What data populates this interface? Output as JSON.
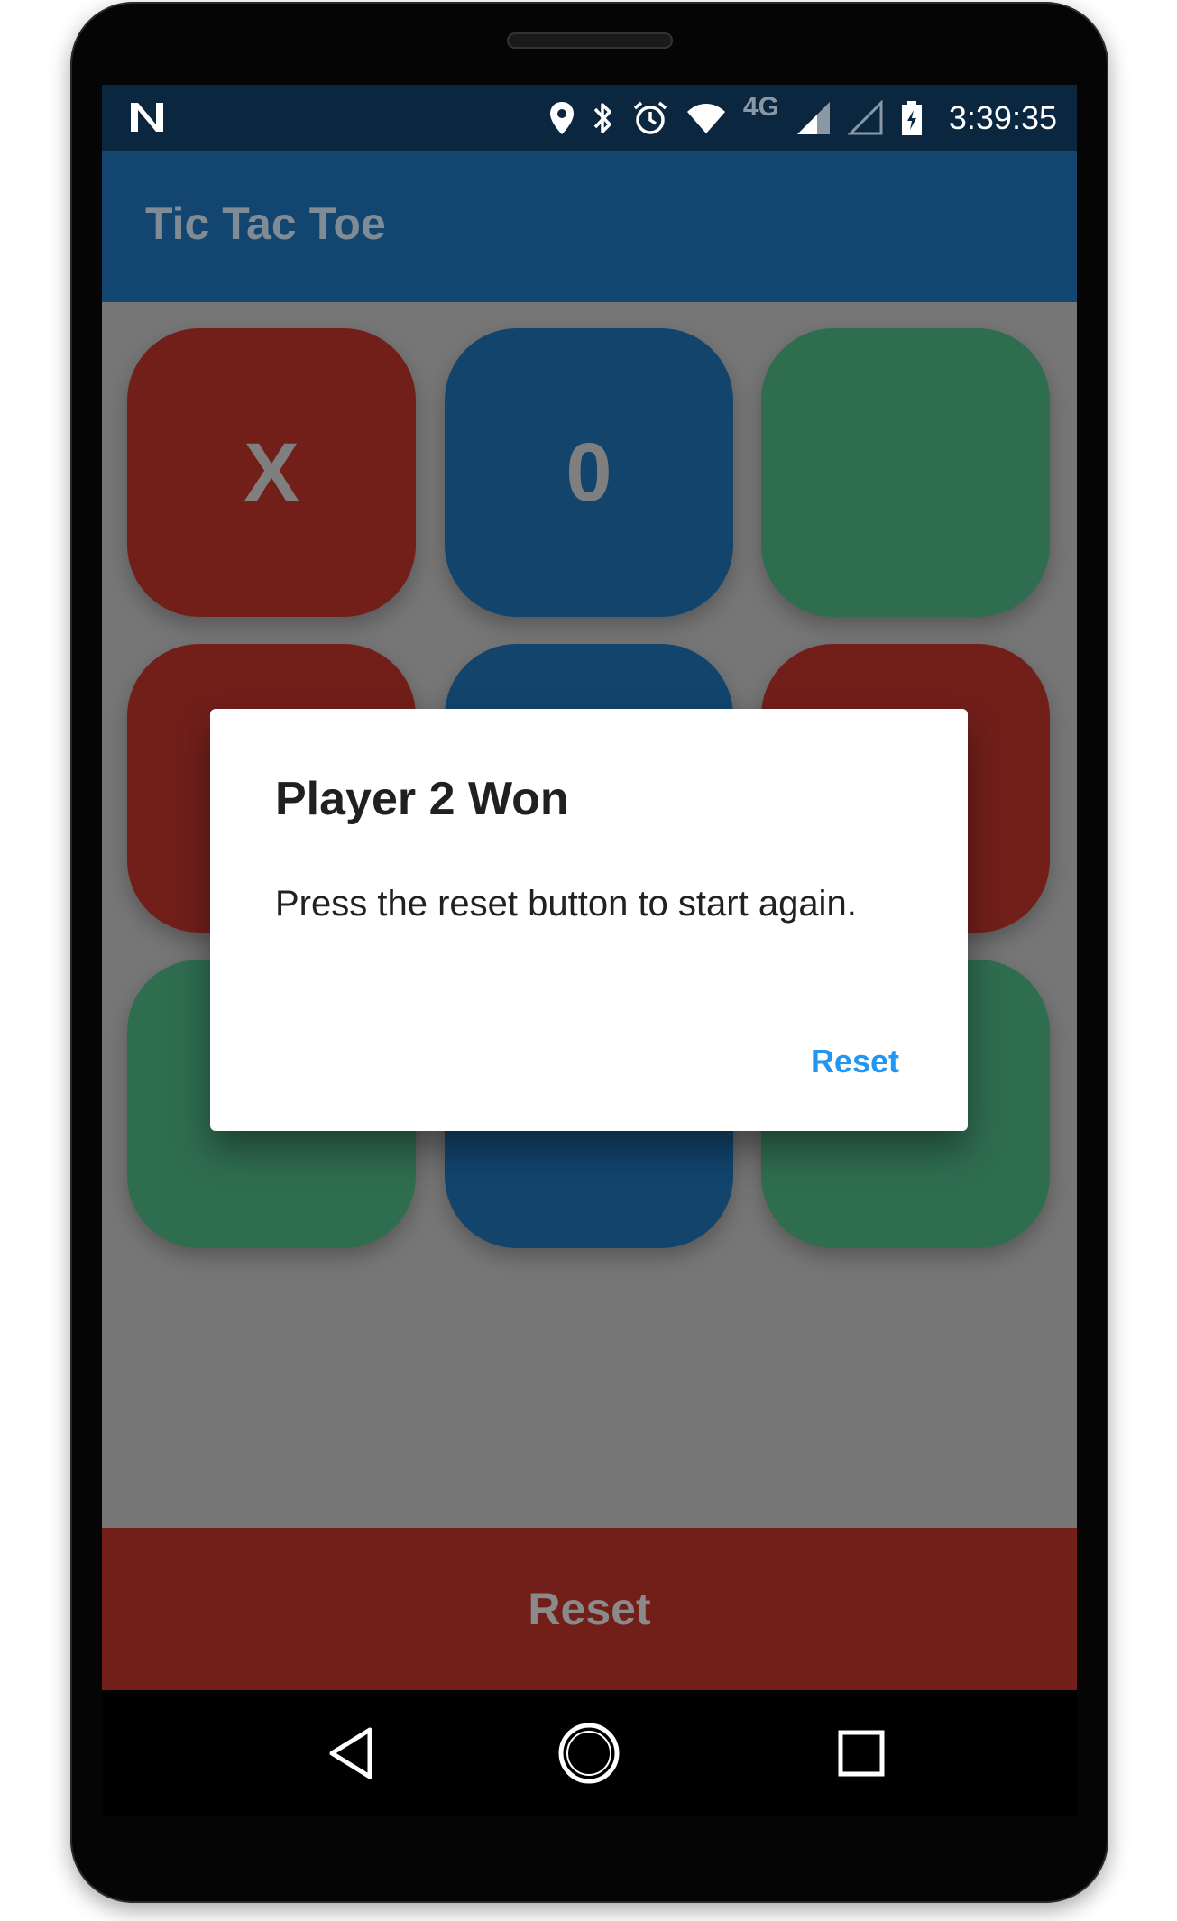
{
  "status_bar": {
    "time": "3:39:35",
    "network_label": "4G",
    "icons": [
      "notification-n-icon",
      "location-pin-icon",
      "bluetooth-icon",
      "alarm-clock-icon",
      "wifi-icon",
      "signal-icon",
      "signal-empty-icon",
      "battery-charging-icon"
    ]
  },
  "app_bar": {
    "title": "Tic Tac Toe"
  },
  "board": {
    "cells": [
      {
        "mark": "X",
        "color": "red"
      },
      {
        "mark": "0",
        "color": "blue"
      },
      {
        "mark": "",
        "color": "green"
      },
      {
        "mark": "",
        "color": "red"
      },
      {
        "mark": "",
        "color": "blue"
      },
      {
        "mark": "",
        "color": "red"
      },
      {
        "mark": "",
        "color": "green"
      },
      {
        "mark": "",
        "color": "blue"
      },
      {
        "mark": "",
        "color": "green"
      }
    ]
  },
  "reset_button": {
    "label": "Reset"
  },
  "dialog": {
    "title": "Player 2 Won",
    "message": "Press the reset button to start again.",
    "action_label": "Reset"
  },
  "nav_bar": {
    "icons": [
      "back-icon",
      "home-icon",
      "recents-icon"
    ]
  },
  "colors": {
    "app_bar": "#124570",
    "status_bar": "#0b2740",
    "red_cell": "#721f1a",
    "blue_cell": "#12446c",
    "green_cell": "#2f6d4f",
    "dialog_action": "#2196f3"
  }
}
